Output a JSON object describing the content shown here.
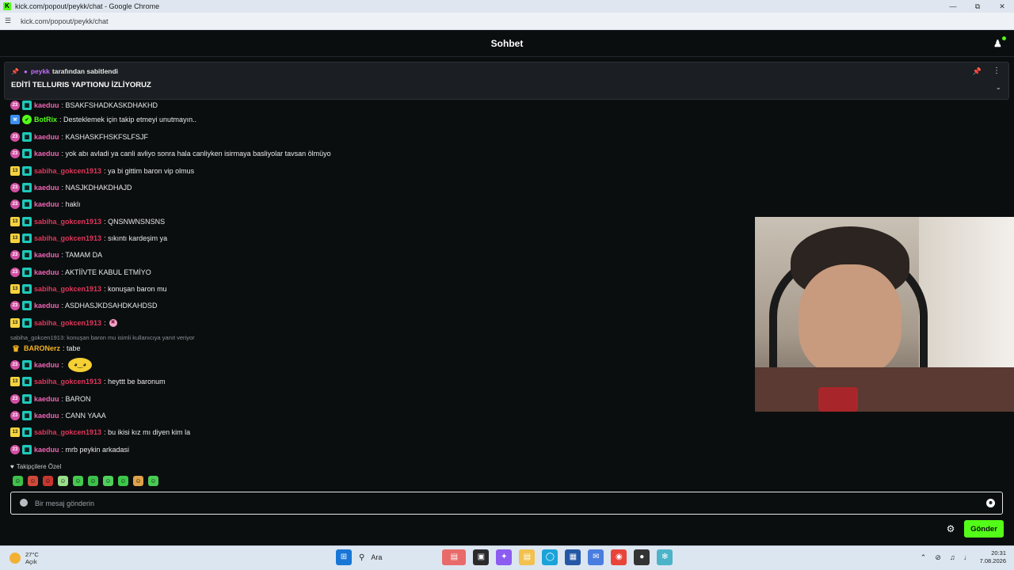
{
  "window": {
    "title": "kick.com/popout/peykk/chat - Google Chrome",
    "url": "kick.com/popout/peykk/chat"
  },
  "header": {
    "title": "Sohbet"
  },
  "pinned": {
    "user": "peykk",
    "suffix": "tarafından sabitlendi",
    "message": "EDİTİ TELLURIS YAPTIONU İZLİYORUZ"
  },
  "messages": [
    {
      "badge": "23",
      "badge_type": "pink",
      "sub": true,
      "user": "kaeduu",
      "color": "pink",
      "text": ": BSAKFSHADKASKDHAKHD"
    },
    {
      "badge": "",
      "badge_type": "bot",
      "sub": false,
      "verified": true,
      "user": "BotRix",
      "color": "green",
      "text": ": Desteklemek için takip etmeyi unutmayın.."
    },
    {
      "badge": "23",
      "badge_type": "pink",
      "sub": true,
      "user": "kaeduu",
      "color": "pink",
      "text": ": KASHASKFHSKFSLFSJF"
    },
    {
      "badge": "23",
      "badge_type": "pink",
      "sub": true,
      "user": "kaeduu",
      "color": "pink",
      "text": ": yok abı avladi ya canli avliyo sonra hala canliyken isirmaya basliyolar tavsan ölmüyo"
    },
    {
      "badge": "13",
      "badge_type": "yellow",
      "sub": true,
      "user": "sabiha_gokcen1913",
      "color": "red",
      "text": ": ya bi gittim baron vip olmus"
    },
    {
      "badge": "23",
      "badge_type": "pink",
      "sub": true,
      "user": "kaeduu",
      "color": "pink",
      "text": ": NASJKDHAKDHAJD"
    },
    {
      "badge": "23",
      "badge_type": "pink",
      "sub": true,
      "user": "kaeduu",
      "color": "pink",
      "text": ": haklı"
    },
    {
      "badge": "13",
      "badge_type": "yellow",
      "sub": true,
      "user": "sabiha_gokcen1913",
      "color": "red",
      "text": ": QNSNWNSNSNS"
    },
    {
      "badge": "13",
      "badge_type": "yellow",
      "sub": true,
      "user": "sabiha_gokcen1913",
      "color": "red",
      "text": ": sıkıntı kardeşim ya"
    },
    {
      "badge": "23",
      "badge_type": "pink",
      "sub": true,
      "user": "kaeduu",
      "color": "pink",
      "text": ": TAMAM DA"
    },
    {
      "badge": "23",
      "badge_type": "pink",
      "sub": true,
      "user": "kaeduu",
      "color": "pink",
      "text": ": AKTİİVTE KABUL ETMİYO"
    },
    {
      "badge": "13",
      "badge_type": "yellow",
      "sub": true,
      "user": "sabiha_gokcen1913",
      "color": "red",
      "text": ": konuşan baron mu"
    },
    {
      "badge": "23",
      "badge_type": "pink",
      "sub": true,
      "user": "kaeduu",
      "color": "pink",
      "text": ": ASDHASJKDSAHDKAHDSD"
    },
    {
      "badge": "13",
      "badge_type": "yellow",
      "sub": true,
      "user": "sabiha_gokcen1913",
      "color": "red",
      "text": ":",
      "emote": "sob"
    },
    {
      "badge": "",
      "badge_type": "crown",
      "sub": false,
      "user": "BARONerz",
      "color": "yellow",
      "text": ": tabe"
    },
    {
      "badge": "23",
      "badge_type": "pink",
      "sub": true,
      "user": "kaeduu",
      "color": "pink",
      "text": ":",
      "emote": "big"
    },
    {
      "badge": "13",
      "badge_type": "yellow",
      "sub": true,
      "user": "sabiha_gokcen1913",
      "color": "red",
      "text": ": heyttt be baronum"
    },
    {
      "badge": "23",
      "badge_type": "pink",
      "sub": true,
      "user": "kaeduu",
      "color": "pink",
      "text": ": BARON"
    },
    {
      "badge": "23",
      "badge_type": "pink",
      "sub": true,
      "user": "kaeduu",
      "color": "pink",
      "text": ": CANN YAAA"
    },
    {
      "badge": "13",
      "badge_type": "yellow",
      "sub": true,
      "user": "sabiha_gokcen1913",
      "color": "red",
      "text": ": bu ikisi kız mı diyen kim la"
    },
    {
      "badge": "23",
      "badge_type": "pink",
      "sub": true,
      "user": "kaeduu",
      "color": "pink",
      "text": ": mrb peykin arkadasi"
    }
  ],
  "reply_note": "sabiha_gokcen1913: konuşan baron mu isimli kullanıcıya yanıt veriyor",
  "followers_only": {
    "label": "Takipçilere Özel",
    "emotes": [
      {
        "icon": "green-frog-emote",
        "color": "#3fc14a"
      },
      {
        "icon": "red-devil-emote",
        "color": "#d0493a"
      },
      {
        "icon": "red-face-emote",
        "color": "#c8362f"
      },
      {
        "icon": "soccer-ball-emote",
        "color": "#9adf8b"
      },
      {
        "icon": "green-blob-emote",
        "color": "#45c94f"
      },
      {
        "icon": "green-ghost-emote",
        "color": "#3cbf4b"
      },
      {
        "icon": "green-smile-emote",
        "color": "#4fd15b"
      },
      {
        "icon": "green-laugh-emote",
        "color": "#3cc749"
      },
      {
        "icon": "party-emote",
        "color": "#e0a24a"
      },
      {
        "icon": "green-wink-emote",
        "color": "#48cc52"
      }
    ]
  },
  "input": {
    "placeholder": "Bir mesaj gönderin"
  },
  "send_label": "Gönder",
  "taskbar": {
    "temp": "27°C",
    "weather": "Açık",
    "search": "Ara",
    "time": "20:31",
    "date": "7.08.2026"
  },
  "colors": {
    "accent": "#53fc18",
    "background": "#0b0e0f"
  }
}
